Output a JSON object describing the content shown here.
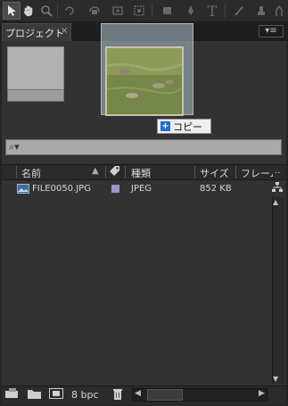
{
  "toolbar": {
    "tools": [
      "selection-tool-icon",
      "hand-tool-icon",
      "zoom-tool-icon",
      "rotate-tool-icon",
      "camera-tool-icon",
      "pan-behind-tool-icon",
      "rectangle-tool-icon",
      "pen-tool-icon",
      "type-tool-icon",
      "brush-tool-icon",
      "puppet-tool-icon"
    ],
    "type_glyph": "T"
  },
  "panel": {
    "tab_label": "プロジェクト",
    "tab_close": "×",
    "menu_glyph": "▾≡"
  },
  "drag": {
    "copy_label": "コピー",
    "plus_glyph": "+"
  },
  "search": {
    "icon_glyph": "⌕▾",
    "value": ""
  },
  "columns": {
    "name": "名前",
    "type": "種類",
    "size": "サイズ",
    "frame": "フレーム"
  },
  "rows": [
    {
      "name": "FILE0050.JPG",
      "type": "JPEG",
      "size": "852 KB"
    }
  ],
  "bottom": {
    "bpc": "8 bpc"
  },
  "colors": {
    "label_swatch": "#9898c8",
    "panel_bg": "#323232"
  }
}
